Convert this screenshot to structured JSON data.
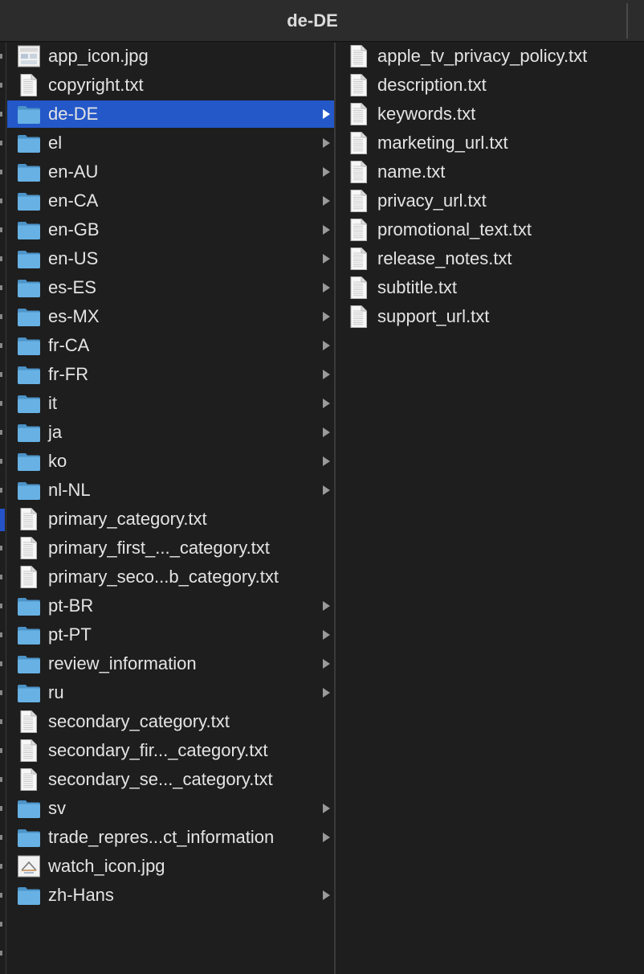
{
  "window": {
    "title": "de-DE"
  },
  "column1": {
    "items": [
      {
        "label": "app_icon.jpg",
        "kind": "image-statics",
        "has_children": false,
        "selected": false
      },
      {
        "label": "copyright.txt",
        "kind": "file",
        "has_children": false,
        "selected": false
      },
      {
        "label": "de-DE",
        "kind": "folder",
        "has_children": true,
        "selected": true
      },
      {
        "label": "el",
        "kind": "folder",
        "has_children": true,
        "selected": false
      },
      {
        "label": "en-AU",
        "kind": "folder",
        "has_children": true,
        "selected": false
      },
      {
        "label": "en-CA",
        "kind": "folder",
        "has_children": true,
        "selected": false
      },
      {
        "label": "en-GB",
        "kind": "folder",
        "has_children": true,
        "selected": false
      },
      {
        "label": "en-US",
        "kind": "folder",
        "has_children": true,
        "selected": false
      },
      {
        "label": "es-ES",
        "kind": "folder",
        "has_children": true,
        "selected": false
      },
      {
        "label": "es-MX",
        "kind": "folder",
        "has_children": true,
        "selected": false
      },
      {
        "label": "fr-CA",
        "kind": "folder",
        "has_children": true,
        "selected": false
      },
      {
        "label": "fr-FR",
        "kind": "folder",
        "has_children": true,
        "selected": false
      },
      {
        "label": "it",
        "kind": "folder",
        "has_children": true,
        "selected": false
      },
      {
        "label": "ja",
        "kind": "folder",
        "has_children": true,
        "selected": false
      },
      {
        "label": "ko",
        "kind": "folder",
        "has_children": true,
        "selected": false
      },
      {
        "label": "nl-NL",
        "kind": "folder",
        "has_children": true,
        "selected": false
      },
      {
        "label": "primary_category.txt",
        "kind": "file",
        "has_children": false,
        "selected": false
      },
      {
        "label": "primary_first_..._category.txt",
        "kind": "file",
        "has_children": false,
        "selected": false
      },
      {
        "label": "primary_seco...b_category.txt",
        "kind": "file",
        "has_children": false,
        "selected": false
      },
      {
        "label": "pt-BR",
        "kind": "folder",
        "has_children": true,
        "selected": false
      },
      {
        "label": "pt-PT",
        "kind": "folder",
        "has_children": true,
        "selected": false
      },
      {
        "label": "review_information",
        "kind": "folder",
        "has_children": true,
        "selected": false
      },
      {
        "label": "ru",
        "kind": "folder",
        "has_children": true,
        "selected": false
      },
      {
        "label": "secondary_category.txt",
        "kind": "file",
        "has_children": false,
        "selected": false
      },
      {
        "label": "secondary_fir..._category.txt",
        "kind": "file",
        "has_children": false,
        "selected": false
      },
      {
        "label": "secondary_se..._category.txt",
        "kind": "file",
        "has_children": false,
        "selected": false
      },
      {
        "label": "sv",
        "kind": "folder",
        "has_children": true,
        "selected": false
      },
      {
        "label": "trade_repres...ct_information",
        "kind": "folder",
        "has_children": true,
        "selected": false
      },
      {
        "label": "watch_icon.jpg",
        "kind": "image-watch",
        "has_children": false,
        "selected": false
      },
      {
        "label": "zh-Hans",
        "kind": "folder",
        "has_children": true,
        "selected": false
      }
    ]
  },
  "column2": {
    "items": [
      {
        "label": "apple_tv_privacy_policy.txt",
        "kind": "file"
      },
      {
        "label": "description.txt",
        "kind": "file"
      },
      {
        "label": "keywords.txt",
        "kind": "file"
      },
      {
        "label": "marketing_url.txt",
        "kind": "file"
      },
      {
        "label": "name.txt",
        "kind": "file"
      },
      {
        "label": "privacy_url.txt",
        "kind": "file"
      },
      {
        "label": "promotional_text.txt",
        "kind": "file"
      },
      {
        "label": "release_notes.txt",
        "kind": "file"
      },
      {
        "label": "subtitle.txt",
        "kind": "file"
      },
      {
        "label": "support_url.txt",
        "kind": "file"
      }
    ]
  },
  "icons": {
    "folder": "folder-icon",
    "file": "text-document-icon",
    "image-statics": "image-thumbnail-icon",
    "image-watch": "image-thumbnail-icon",
    "chevron": "chevron-right-icon"
  },
  "colors": {
    "background": "#1e1e1e",
    "selection": "#2458c9",
    "text": "#e4e4e4",
    "folder": "#5aa9de"
  }
}
